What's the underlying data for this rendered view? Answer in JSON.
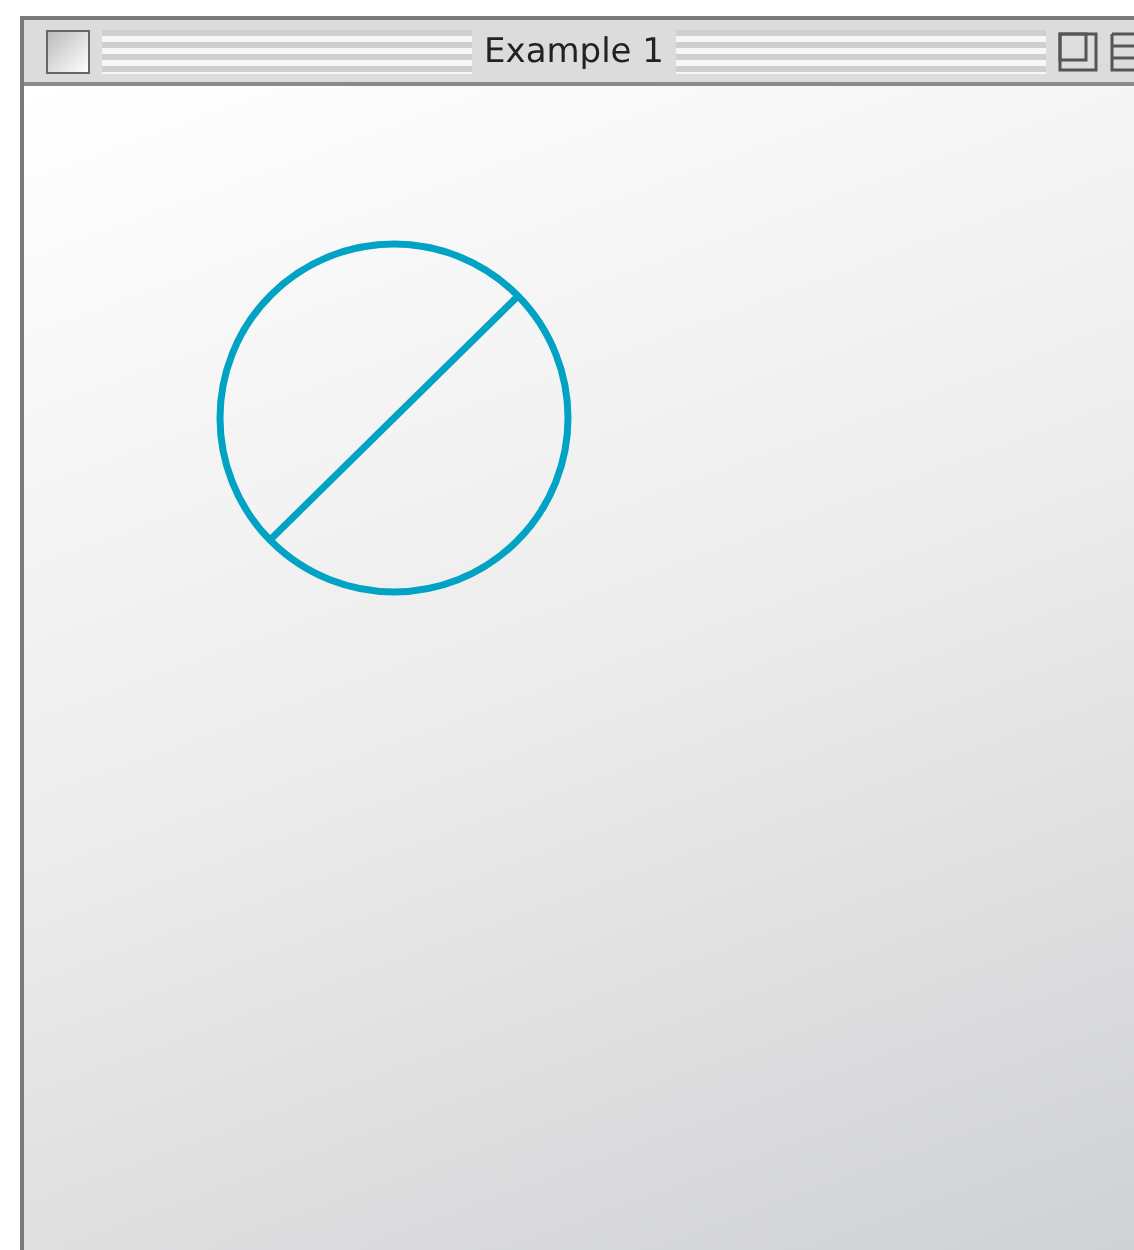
{
  "window": {
    "title": "Example 1"
  }
}
